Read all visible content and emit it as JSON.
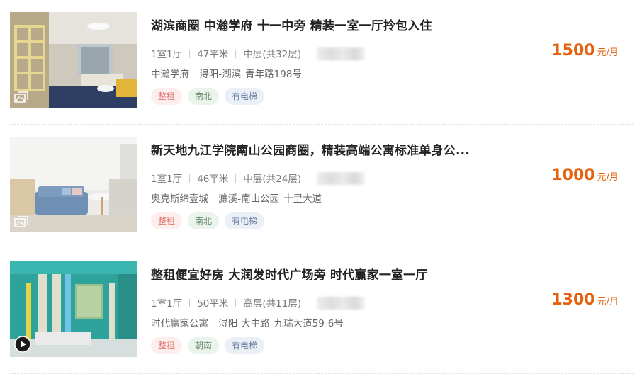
{
  "listings": [
    {
      "title": "湖滨商圈 中瀚学府 十一中旁 精装一室一厅拎包入住",
      "layout": "1室1厅",
      "area": "47平米",
      "floor": "中层(共32层)",
      "community": "中瀚学府",
      "district": "浔阳-湖滨",
      "road": "青年路198号",
      "tags": [
        "整租",
        "南北",
        "有电梯"
      ],
      "price": "1500",
      "price_unit": "元/月",
      "media_icon": "gallery-icon"
    },
    {
      "title": "新天地九江学院南山公园商圈，精装高端公寓标准单身公...",
      "layout": "1室1厅",
      "area": "46平米",
      "floor": "中层(共24层)",
      "community": "奥克斯缔壹城",
      "district": "濂溪-南山公园",
      "road": "十里大道",
      "tags": [
        "整租",
        "南北",
        "有电梯"
      ],
      "price": "1000",
      "price_unit": "元/月",
      "media_icon": "gallery-icon"
    },
    {
      "title": "整租便宜好房 大润发时代广场旁 时代赢家一室一厅",
      "layout": "1室1厅",
      "area": "50平米",
      "floor": "高层(共11层)",
      "community": "时代赢家公寓",
      "district": "浔阳-大中路",
      "road": "九瑞大道59-6号",
      "tags": [
        "整租",
        "朝南",
        "有电梯"
      ],
      "price": "1300",
      "price_unit": "元/月",
      "media_icon": "video-play-icon"
    }
  ]
}
